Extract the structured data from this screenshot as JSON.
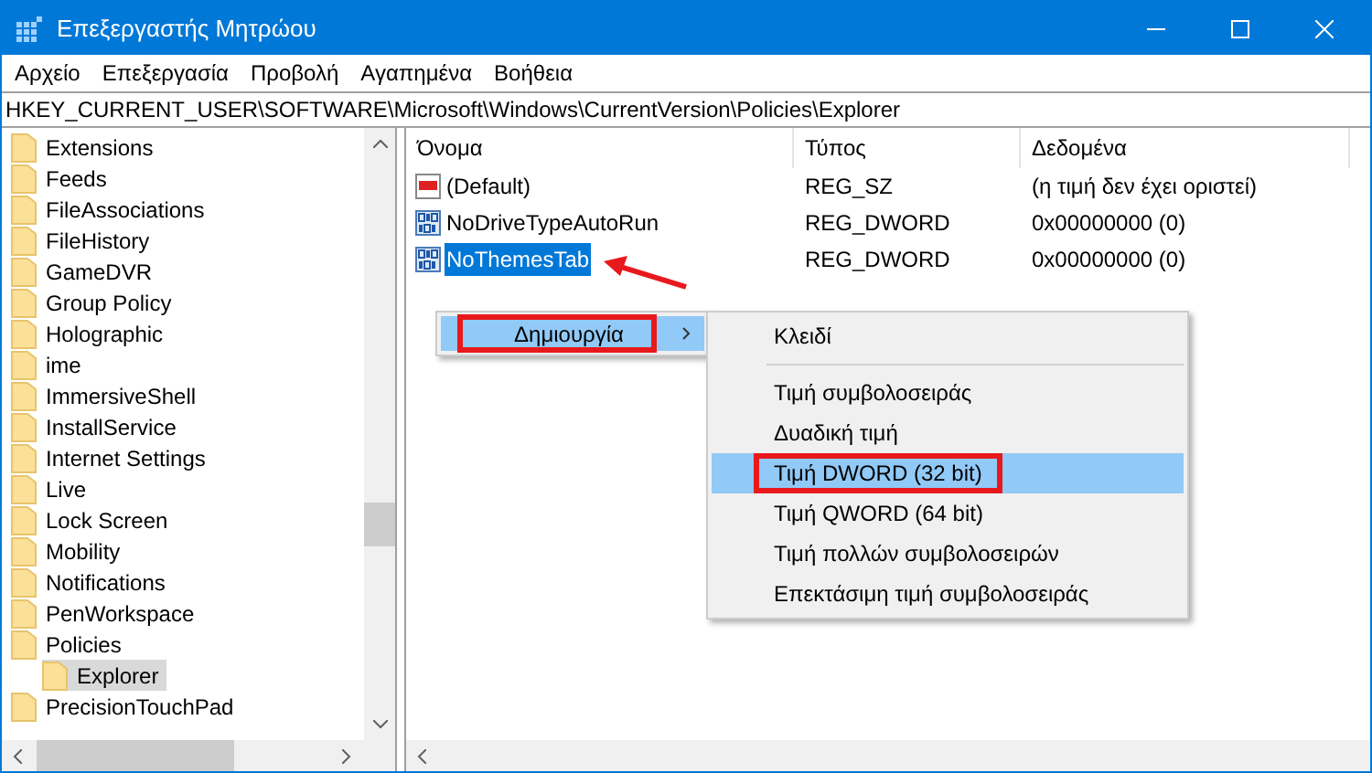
{
  "window": {
    "title": "Επεξεργαστής Μητρώου"
  },
  "menu": [
    "Αρχείο",
    "Επεξεργασία",
    "Προβολή",
    "Αγαπημένα",
    "Βοήθεια"
  ],
  "address": "HKEY_CURRENT_USER\\SOFTWARE\\Microsoft\\Windows\\CurrentVersion\\Policies\\Explorer",
  "tree": [
    {
      "label": "Extensions",
      "selected": false
    },
    {
      "label": "Feeds",
      "selected": false
    },
    {
      "label": "FileAssociations",
      "selected": false
    },
    {
      "label": "FileHistory",
      "selected": false
    },
    {
      "label": "GameDVR",
      "selected": false
    },
    {
      "label": "Group Policy",
      "selected": false
    },
    {
      "label": "Holographic",
      "selected": false
    },
    {
      "label": "ime",
      "selected": false
    },
    {
      "label": "ImmersiveShell",
      "selected": false
    },
    {
      "label": "InstallService",
      "selected": false
    },
    {
      "label": "Internet Settings",
      "selected": false
    },
    {
      "label": "Live",
      "selected": false
    },
    {
      "label": "Lock Screen",
      "selected": false
    },
    {
      "label": "Mobility",
      "selected": false
    },
    {
      "label": "Notifications",
      "selected": false
    },
    {
      "label": "PenWorkspace",
      "selected": false
    },
    {
      "label": "Policies",
      "selected": false,
      "children": [
        {
          "label": "Explorer",
          "selected": true
        }
      ]
    },
    {
      "label": "PrecisionTouchPad",
      "selected": false
    }
  ],
  "table": {
    "columns": [
      "Όνομα",
      "Τύπος",
      "Δεδομένα"
    ],
    "rows": [
      {
        "kind": "string",
        "name": "(Default)",
        "type": "REG_SZ",
        "data": "(η τιμή δεν έχει οριστεί)",
        "selected": false
      },
      {
        "kind": "binary",
        "name": "NoDriveTypeAutoRun",
        "type": "REG_DWORD",
        "data": "0x00000000 (0)",
        "selected": false
      },
      {
        "kind": "binary",
        "name": "NoThemesTab",
        "type": "REG_DWORD",
        "data": "0x00000000 (0)",
        "selected": true
      }
    ]
  },
  "context_menu": {
    "items": [
      {
        "label": "Δημιουργία",
        "submenu": true,
        "selected": true,
        "highlighted": true
      }
    ]
  },
  "submenu": {
    "items": [
      {
        "label": "Κλειδί",
        "selected": false,
        "highlighted": false,
        "separator_after": true
      },
      {
        "label": "Τιμή συμβολοσειράς",
        "selected": false,
        "highlighted": false,
        "separator_after": false
      },
      {
        "label": "Δυαδική τιμή",
        "selected": false,
        "highlighted": false,
        "separator_after": false
      },
      {
        "label": "Τιμή DWORD (32 bit)",
        "selected": true,
        "highlighted": true,
        "separator_after": false
      },
      {
        "label": "Τιμή QWORD (64 bit)",
        "selected": false,
        "highlighted": false,
        "separator_after": false
      },
      {
        "label": "Τιμή πολλών συμβολοσειρών",
        "selected": false,
        "highlighted": false,
        "separator_after": false
      },
      {
        "label": "Επεκτάσιμη τιμή συμβολοσειράς",
        "selected": false,
        "highlighted": false,
        "separator_after": false
      }
    ]
  }
}
